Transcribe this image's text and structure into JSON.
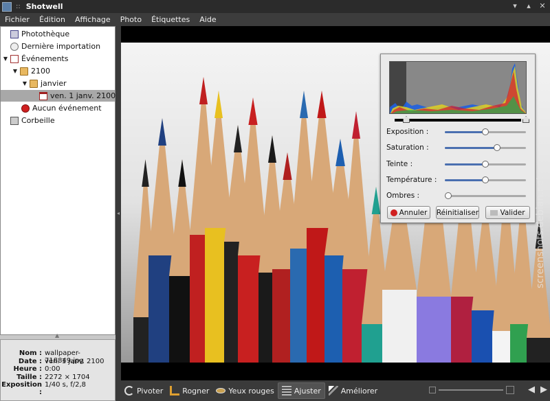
{
  "window": {
    "title": "Shotwell",
    "decoration": "::",
    "controls": [
      "▾",
      "▴",
      "✕"
    ]
  },
  "menubar": [
    "Fichier",
    "Édition",
    "Affichage",
    "Photo",
    "Étiquettes",
    "Aide"
  ],
  "sidebar": {
    "items": [
      {
        "label": "Photothèque",
        "icon": "library-icon"
      },
      {
        "label": "Dernière importation",
        "icon": "import-icon"
      },
      {
        "label": "Événements",
        "icon": "events-icon",
        "expanded": true
      },
      {
        "label": "2100",
        "icon": "folder-icon",
        "expanded": true
      },
      {
        "label": "janvier",
        "icon": "folder-icon",
        "expanded": true
      },
      {
        "label": "ven. 1 janv. 2100",
        "icon": "calendar-icon",
        "selected": true
      },
      {
        "label": "Aucun événement",
        "icon": "no-event-icon"
      },
      {
        "label": "Corbeille",
        "icon": "trash-icon"
      }
    ]
  },
  "info": {
    "rows": [
      {
        "key": "Nom :",
        "value": "wallpaper-718849.jpg"
      },
      {
        "key": "Date :",
        "value": "ven. 1 janv. 2100"
      },
      {
        "key": "Heure :",
        "value": "0:00"
      },
      {
        "key": "Taille :",
        "value": "2272 × 1704"
      },
      {
        "key": "Exposition :",
        "value": "1/40 s, f/2,8"
      }
    ]
  },
  "adjust": {
    "sliders": [
      {
        "label": "Exposition :",
        "level": 0.5
      },
      {
        "label": "Saturation :",
        "level": 0.66
      },
      {
        "label": "Teinte :",
        "level": 0.5
      },
      {
        "label": "Température :",
        "level": 0.5
      },
      {
        "label": "Ombres :",
        "level": 0.0
      }
    ],
    "buttons": {
      "cancel": "Annuler",
      "reset": "Réinitialiser",
      "ok": "Valider"
    }
  },
  "toolbar": {
    "rotate": "Pivoter",
    "crop": "Rogner",
    "redeye": "Yeux rouges",
    "adjust": "Ajuster",
    "enhance": "Améliorer"
  },
  "watermark": "screenshots.debian.net",
  "colors": {
    "accent": "#4a6fb0",
    "selection": "#a8a8a8",
    "chrome": "#3a3a3a"
  }
}
